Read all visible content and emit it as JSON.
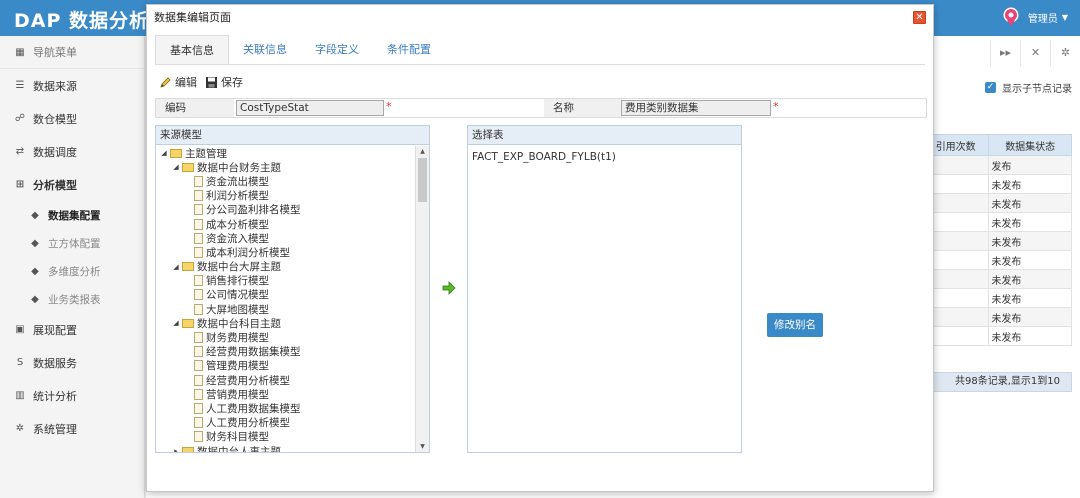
{
  "app": {
    "title": "DAP 数据分析平",
    "user": "管理员"
  },
  "sidebar": {
    "items": [
      {
        "label": "导航菜单",
        "icon": "grid-icon",
        "glyph": "▦",
        "kind": "nav-header"
      },
      {
        "label": "数据来源",
        "icon": "database-icon",
        "glyph": "☰",
        "kind": "group"
      },
      {
        "label": "数仓模型",
        "icon": "cubes-icon",
        "glyph": "☍",
        "kind": "group"
      },
      {
        "label": "数据调度",
        "icon": "shuffle-icon",
        "glyph": "⇄",
        "kind": "group"
      },
      {
        "label": "分析模型",
        "icon": "model-icon",
        "glyph": "⊞",
        "kind": "group-open"
      },
      {
        "label": "数据集配置",
        "icon": "leaf-icon",
        "glyph": "◆",
        "kind": "sub active"
      },
      {
        "label": "立方体配置",
        "icon": "leaf-icon",
        "glyph": "◆",
        "kind": "sub"
      },
      {
        "label": "多维度分析",
        "icon": "leaf-icon",
        "glyph": "◆",
        "kind": "sub"
      },
      {
        "label": "业务类报表",
        "icon": "leaf-icon",
        "glyph": "◆",
        "kind": "sub"
      },
      {
        "label": "展现配置",
        "icon": "film-icon",
        "glyph": "▣",
        "kind": "group"
      },
      {
        "label": "数据服务",
        "icon": "service-icon",
        "glyph": "S",
        "kind": "group"
      },
      {
        "label": "统计分析",
        "icon": "bar-chart-icon",
        "glyph": "▥",
        "kind": "group"
      },
      {
        "label": "系统管理",
        "icon": "gear-icon",
        "glyph": "✲",
        "kind": "group"
      }
    ]
  },
  "background": {
    "toolbar": [
      {
        "icon": "forward-icon",
        "glyph": "▸▸"
      },
      {
        "icon": "expand-icon",
        "glyph": "✕"
      },
      {
        "icon": "settings-icon",
        "glyph": "✲"
      }
    ],
    "show_children_label": "显示子节点记录",
    "table_headers": [
      "引用次数",
      "数据集状态"
    ],
    "table_rows": [
      [
        "",
        "发布"
      ],
      [
        "",
        "未发布"
      ],
      [
        "",
        "未发布"
      ],
      [
        "",
        "未发布"
      ],
      [
        "",
        "未发布"
      ],
      [
        "",
        "未发布"
      ],
      [
        "",
        "未发布"
      ],
      [
        "",
        "未发布"
      ],
      [
        "",
        "未发布"
      ],
      [
        "",
        "未发布"
      ]
    ],
    "pager_text": "共98条记录,显示1到10"
  },
  "dialog": {
    "title": "数据集编辑页面",
    "tabs": [
      {
        "label": "基本信息",
        "active": true
      },
      {
        "label": "关联信息",
        "active": false
      },
      {
        "label": "字段定义",
        "active": false
      },
      {
        "label": "条件配置",
        "active": false
      }
    ],
    "actions": {
      "edit": "编辑",
      "save": "保存"
    },
    "code_label": "编码",
    "code_value": "CostTypeStat",
    "name_label": "名称",
    "name_value": "费用类别数据集",
    "required_mark": "*",
    "source_title": "来源模型",
    "selected_title": "选择表",
    "selected_item": "FACT_EXP_BOARD_FYLB(t1)",
    "rename_label": "修改别名",
    "tree": [
      {
        "label": "主题管理",
        "level": 0,
        "type": "folder",
        "open": true
      },
      {
        "label": "数据中台财务主题",
        "level": 1,
        "type": "folder",
        "open": true
      },
      {
        "label": "资金流出模型",
        "level": 2,
        "type": "doc"
      },
      {
        "label": "利润分析模型",
        "level": 2,
        "type": "doc"
      },
      {
        "label": "分公司盈利排名模型",
        "level": 2,
        "type": "doc"
      },
      {
        "label": "成本分析模型",
        "level": 2,
        "type": "doc"
      },
      {
        "label": "资金流入模型",
        "level": 2,
        "type": "doc"
      },
      {
        "label": "成本利润分析模型",
        "level": 2,
        "type": "doc"
      },
      {
        "label": "数据中台大屏主题",
        "level": 1,
        "type": "folder",
        "open": true
      },
      {
        "label": "销售排行模型",
        "level": 2,
        "type": "doc"
      },
      {
        "label": "公司情况模型",
        "level": 2,
        "type": "doc"
      },
      {
        "label": "大屏地图模型",
        "level": 2,
        "type": "doc"
      },
      {
        "label": "数据中台科目主题",
        "level": 1,
        "type": "folder",
        "open": true
      },
      {
        "label": "财务费用模型",
        "level": 2,
        "type": "doc"
      },
      {
        "label": "经营费用数据集模型",
        "level": 2,
        "type": "doc"
      },
      {
        "label": "管理费用模型",
        "level": 2,
        "type": "doc"
      },
      {
        "label": "经营费用分析模型",
        "level": 2,
        "type": "doc"
      },
      {
        "label": "营销费用模型",
        "level": 2,
        "type": "doc"
      },
      {
        "label": "人工费用数据集模型",
        "level": 2,
        "type": "doc"
      },
      {
        "label": "人工费用分析模型",
        "level": 2,
        "type": "doc"
      },
      {
        "label": "财务科目模型",
        "level": 2,
        "type": "doc"
      },
      {
        "label": "数据中台人事主题",
        "level": 1,
        "type": "folder",
        "open": false
      }
    ]
  }
}
